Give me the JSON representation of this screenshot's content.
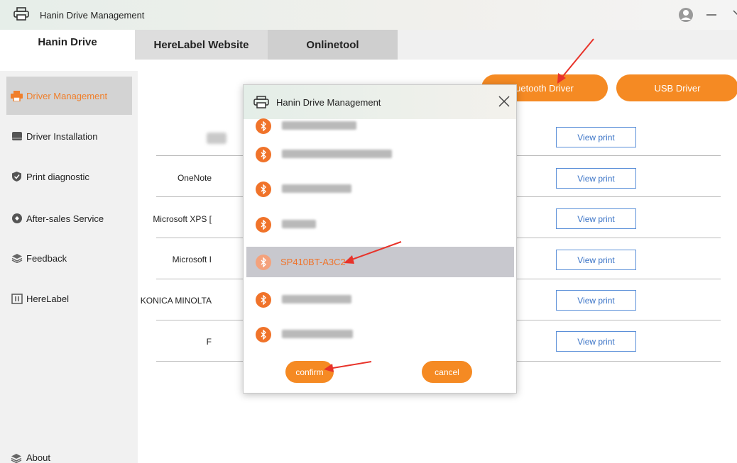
{
  "window": {
    "title": "Hanin Drive Management",
    "icons": [
      "printer-icon",
      "user-icon",
      "minimize-icon",
      "close-icon"
    ]
  },
  "tabs": [
    {
      "label": "Hanin Drive",
      "active": true
    },
    {
      "label": "HereLabel Website",
      "active": false
    },
    {
      "label": "Onlinetool",
      "active": false
    }
  ],
  "sidebar": {
    "items": [
      {
        "label": "Driver Management",
        "icon": "printer-icon",
        "active": true
      },
      {
        "label": "Driver Installation",
        "icon": "driver-icon"
      },
      {
        "label": "Print diagnostic",
        "icon": "shield-icon"
      },
      {
        "label": "After-sales Service",
        "icon": "support-icon"
      },
      {
        "label": "Feedback",
        "icon": "layers-icon"
      },
      {
        "label": "HereLabel",
        "icon": "label-icon"
      }
    ],
    "about": "About"
  },
  "actions": {
    "bluetooth_driver": "uetooth Driver",
    "usb_driver": "USB Driver"
  },
  "printers": [
    {
      "name": "",
      "view": "View print"
    },
    {
      "name": "OneNote",
      "view": "View print"
    },
    {
      "name": "Microsoft XPS [",
      "view": "View print"
    },
    {
      "name": "Microsoft I",
      "view": "View print"
    },
    {
      "name": "KONICA MINOLTA",
      "view": "View print"
    },
    {
      "name": "F",
      "view": "View print"
    }
  ],
  "dialog": {
    "title": "Hanin Drive Management",
    "devices": [
      {
        "name": "",
        "selected": false
      },
      {
        "name": "",
        "selected": false
      },
      {
        "name": "",
        "selected": false
      },
      {
        "name": "",
        "selected": false
      },
      {
        "name": "SP410BT-A3C2",
        "selected": true
      },
      {
        "name": "",
        "selected": false
      },
      {
        "name": "",
        "selected": false
      }
    ],
    "confirm": "confirm",
    "cancel": "cancel"
  },
  "colors": {
    "accent": "#f58a23",
    "bluetooth": "#f0732a",
    "link_blue": "#3a73c6",
    "annotation": "#e8332a"
  }
}
